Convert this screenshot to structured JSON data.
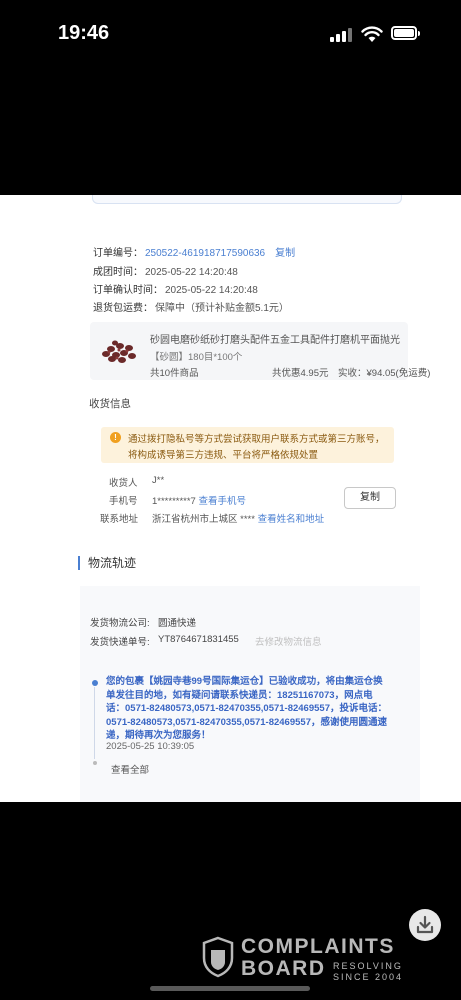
{
  "status_bar": {
    "time": "19:46"
  },
  "order": {
    "order_no_label": "订单编号：",
    "order_no": "250522-461918717590636",
    "copy_label": "复制",
    "created_label": "成团时间：",
    "created": "2025-05-22 14:20:48",
    "confirmed_label": "订单确认时间：",
    "confirmed": "2025-05-22 14:20:48",
    "return_label": "退货包运费：",
    "return_value": "保障中（预计补贴金额5.1元）"
  },
  "product": {
    "title": "砂圆电磨砂纸砂打磨头配件五金工具配件打磨机平面抛光打",
    "spec": "【砂圆】180目*100个",
    "count": "共10件商品",
    "discount": "共优惠4.95元",
    "actual": "实收：¥94.05(免运费)"
  },
  "receiver": {
    "section_title": "收货信息",
    "notice_line1": "通过拨打隐私号等方式尝试获取用户联系方式或第三方账号，",
    "notice_line2": "将构成诱导第三方违规、平台将严格依规处置",
    "name_label": "收货人",
    "name": "J**",
    "phone_label": "手机号",
    "phone": "1*********7",
    "view_phone": "查看手机号",
    "address_label": "联系地址",
    "address": "浙江省杭州市上城区 ****",
    "view_name_address": "查看姓名和地址",
    "copy_button": "复制"
  },
  "logistics": {
    "title": "物流轨迹",
    "company_label": "发货物流公司:",
    "company": "圆通快递",
    "tracking_label": "发货快递单号:",
    "tracking_no": "YT8764671831455",
    "change_info": "去修改物流信息",
    "track_text": "您的包裹【姚园寺巷99号国际集运仓】已验收成功，将由集运仓换单发往目的地，如有疑问请联系快递员：18251167073，网点电话：0571-82480573,0571-82470355,0571-82469557，投诉电话：0571-82480573,0571-82470355,0571-82469557，感谢使用圆通速递，期待再次为您服务！",
    "track_time": "2025-05-25 10:39:05",
    "view_all": "查看全部"
  },
  "watermark": {
    "line1": "COMPLAINTS",
    "line2": "BOARD",
    "tag1": "RESOLVING",
    "tag2": "SINCE 2004"
  }
}
